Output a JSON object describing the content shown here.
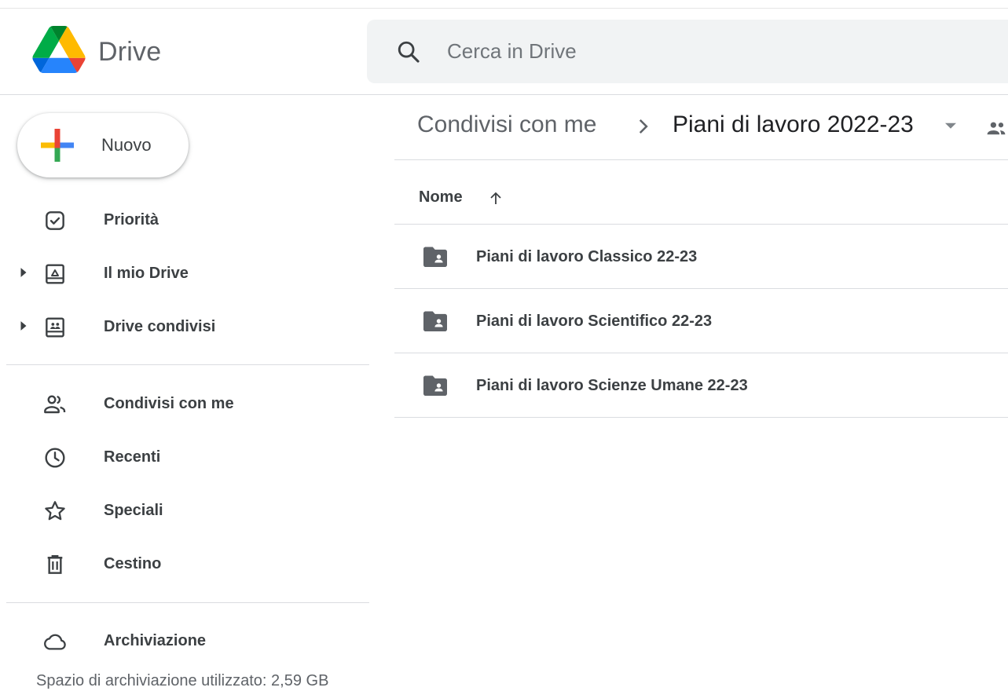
{
  "header": {
    "app_name": "Drive",
    "search_placeholder": "Cerca in Drive"
  },
  "sidebar": {
    "new_label": "Nuovo",
    "items": [
      {
        "label": "Priorità",
        "icon": "priority-check-icon"
      },
      {
        "label": "Il mio Drive",
        "icon": "my-drive-icon",
        "expandable": true
      },
      {
        "label": "Drive condivisi",
        "icon": "shared-drives-icon",
        "expandable": true
      },
      {
        "label": "Condivisi con me",
        "icon": "people-icon"
      },
      {
        "label": "Recenti",
        "icon": "clock-icon"
      },
      {
        "label": "Speciali",
        "icon": "star-icon"
      },
      {
        "label": "Cestino",
        "icon": "trash-icon"
      },
      {
        "label": "Archiviazione",
        "icon": "cloud-icon"
      }
    ],
    "storage_text": "Spazio di archiviazione utilizzato: 2,59 GB"
  },
  "main": {
    "breadcrumb": [
      "Condivisi con me",
      "Piani di lavoro 2022-23"
    ],
    "column_name": "Nome",
    "files": [
      {
        "name": "Piani di lavoro Classico 22-23",
        "icon": "shared-folder-icon"
      },
      {
        "name": "Piani di lavoro Scientifico 22-23",
        "icon": "shared-folder-icon"
      },
      {
        "name": "Piani di lavoro Scienze Umane 22-23",
        "icon": "shared-folder-icon"
      }
    ]
  },
  "colors": {
    "text": "#3c4043",
    "muted": "#5f6368",
    "search_bg": "#f1f3f4",
    "divider": "#dadce0",
    "google_blue": "#4285f4",
    "google_red": "#ea4335",
    "google_yellow": "#fbbc04",
    "google_green": "#34a853"
  }
}
